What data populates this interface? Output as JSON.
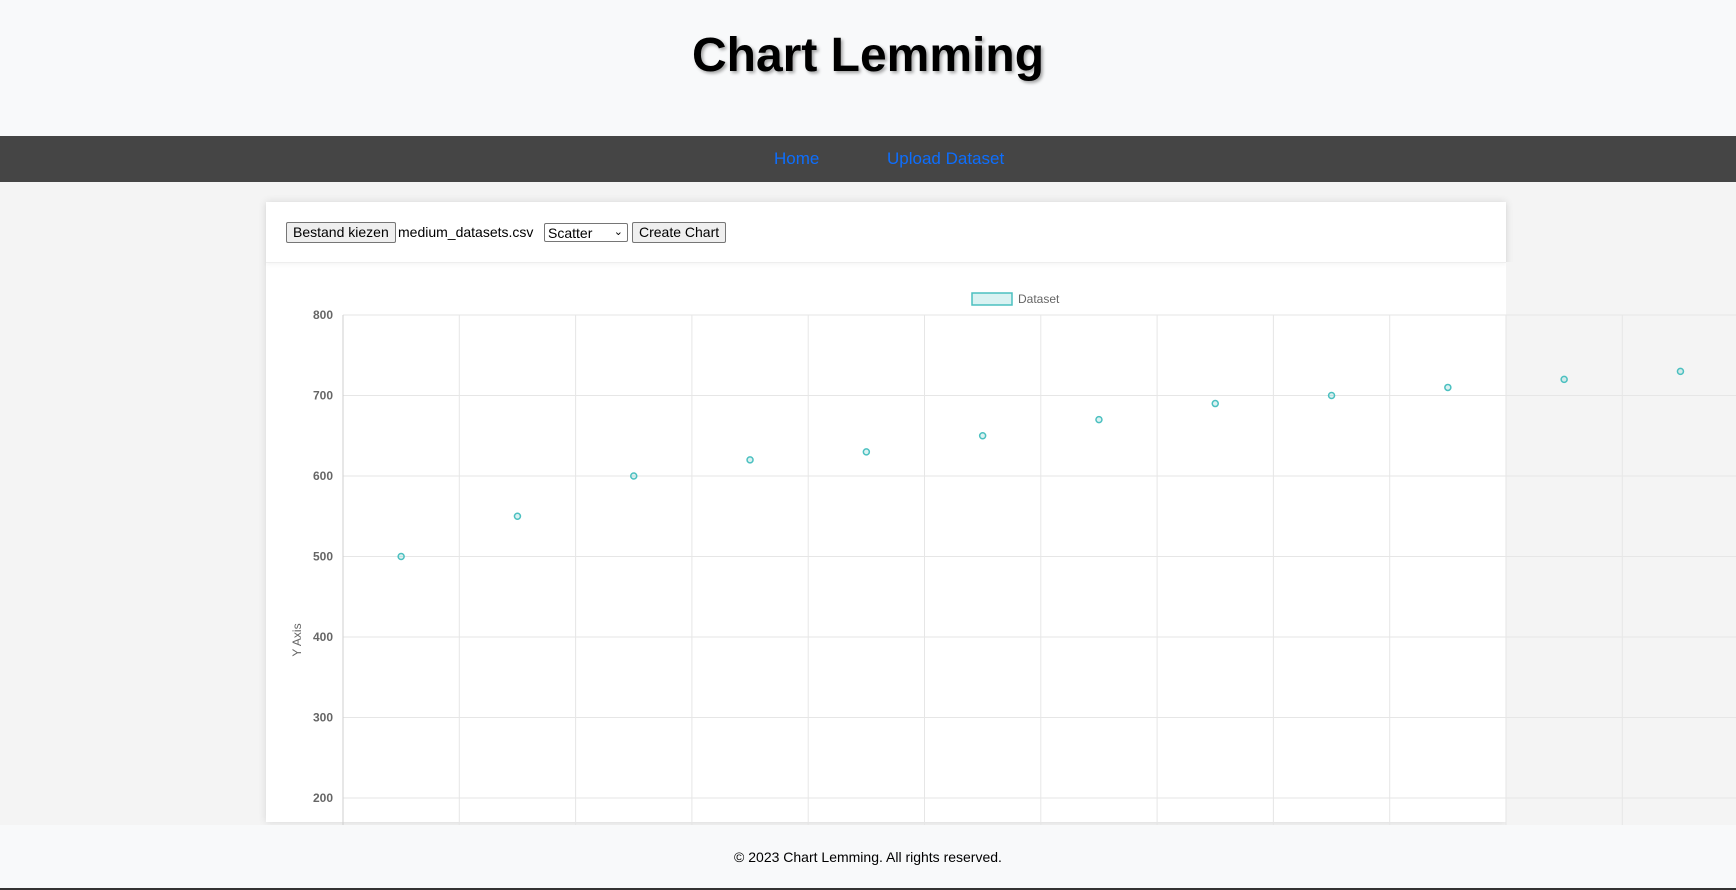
{
  "header": {
    "title": "Chart Lemming"
  },
  "nav": {
    "home": "Home",
    "upload": "Upload Dataset"
  },
  "controls": {
    "file_button": "Bestand kiezen",
    "file_name": "medium_datasets.csv",
    "chart_type": "Scatter",
    "create_button": "Create Chart"
  },
  "footer": {
    "text": "© 2023 Chart Lemming. All rights reserved."
  },
  "chart_data": {
    "type": "scatter",
    "legend": [
      "Dataset"
    ],
    "legend_position": "top",
    "ylabel": "Y Axis",
    "ylim": [
      200,
      800
    ],
    "yticks": [
      800,
      700,
      600,
      500,
      400,
      300,
      200
    ],
    "grid": true,
    "colors": {
      "point": "#4bc0c0",
      "legend_fill": "#d9f2f2"
    },
    "series": [
      {
        "name": "Dataset",
        "x": [
          1,
          2,
          3,
          4,
          5,
          6,
          7,
          8,
          9,
          10,
          11,
          12
        ],
        "y": [
          500,
          550,
          600,
          620,
          630,
          650,
          670,
          690,
          700,
          710,
          720,
          730
        ]
      }
    ]
  }
}
